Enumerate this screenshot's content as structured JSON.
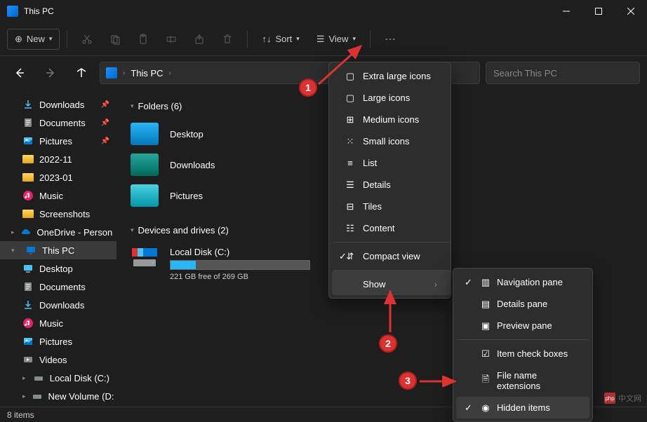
{
  "window": {
    "title": "This PC"
  },
  "toolbar": {
    "new_label": "New",
    "sort_label": "Sort",
    "view_label": "View"
  },
  "address": {
    "location": "This PC"
  },
  "search": {
    "placeholder": "Search This PC"
  },
  "sidebar": {
    "items": [
      {
        "label": "Downloads",
        "icon": "download",
        "pinned": true,
        "indent": true
      },
      {
        "label": "Documents",
        "icon": "document",
        "pinned": true,
        "indent": true
      },
      {
        "label": "Pictures",
        "icon": "picture",
        "pinned": true,
        "indent": true
      },
      {
        "label": "2022-11",
        "icon": "folder",
        "indent": true
      },
      {
        "label": "2023-01",
        "icon": "folder",
        "indent": true
      },
      {
        "label": "Music",
        "icon": "music",
        "indent": true
      },
      {
        "label": "Screenshots",
        "icon": "folder",
        "indent": true
      },
      {
        "label": "OneDrive - Person",
        "icon": "onedrive",
        "chevron": true
      },
      {
        "label": "This PC",
        "icon": "pc",
        "selected": true,
        "chevron": true,
        "expanded": true
      },
      {
        "label": "Desktop",
        "icon": "desktop",
        "indent": true
      },
      {
        "label": "Documents",
        "icon": "document",
        "indent": true
      },
      {
        "label": "Downloads",
        "icon": "download",
        "indent": true
      },
      {
        "label": "Music",
        "icon": "music",
        "indent": true
      },
      {
        "label": "Pictures",
        "icon": "picture",
        "indent": true
      },
      {
        "label": "Videos",
        "icon": "video",
        "indent": true
      },
      {
        "label": "Local Disk (C:)",
        "icon": "disk",
        "chevron": true,
        "indent": true
      },
      {
        "label": "New Volume (D:",
        "icon": "disk",
        "chevron": true,
        "indent": true
      }
    ]
  },
  "content": {
    "folders_header": "Folders (6)",
    "folders": [
      {
        "label": "Desktop",
        "color": "blue"
      },
      {
        "label": "Downloads",
        "color": "green"
      },
      {
        "label": "Pictures",
        "color": "cyan"
      }
    ],
    "drives_header": "Devices and drives (2)",
    "drives": [
      {
        "label": "Local Disk (C:)",
        "free_text": "221 GB free of 269 GB",
        "fill_pct": 18
      }
    ]
  },
  "view_menu": {
    "items": [
      {
        "label": "Extra large icons",
        "icon": "xl"
      },
      {
        "label": "Large icons",
        "icon": "lg"
      },
      {
        "label": "Medium icons",
        "icon": "md"
      },
      {
        "label": "Small icons",
        "icon": "sm"
      },
      {
        "label": "List",
        "icon": "list"
      },
      {
        "label": "Details",
        "icon": "details"
      },
      {
        "label": "Tiles",
        "icon": "tiles",
        "checked": false
      },
      {
        "label": "Content",
        "icon": "content"
      },
      {
        "label": "Compact view",
        "icon": "compact",
        "checked": true,
        "sep": true
      },
      {
        "label": "Show",
        "submenu": true,
        "highlighted": true,
        "sep": true
      }
    ]
  },
  "show_menu": {
    "items": [
      {
        "label": "Navigation pane",
        "icon": "nav",
        "checked": true
      },
      {
        "label": "Details pane",
        "icon": "details"
      },
      {
        "label": "Preview pane",
        "icon": "preview"
      },
      {
        "label": "Item check boxes",
        "icon": "checkbox",
        "sep": true
      },
      {
        "label": "File name extensions",
        "icon": "ext"
      },
      {
        "label": "Hidden items",
        "icon": "hidden",
        "checked": true,
        "highlighted": true
      }
    ]
  },
  "status": {
    "text": "8 items"
  },
  "annotations": {
    "a1": "1",
    "a2": "2",
    "a3": "3"
  },
  "watermark": {
    "text": "中文网",
    "logo": "php"
  }
}
